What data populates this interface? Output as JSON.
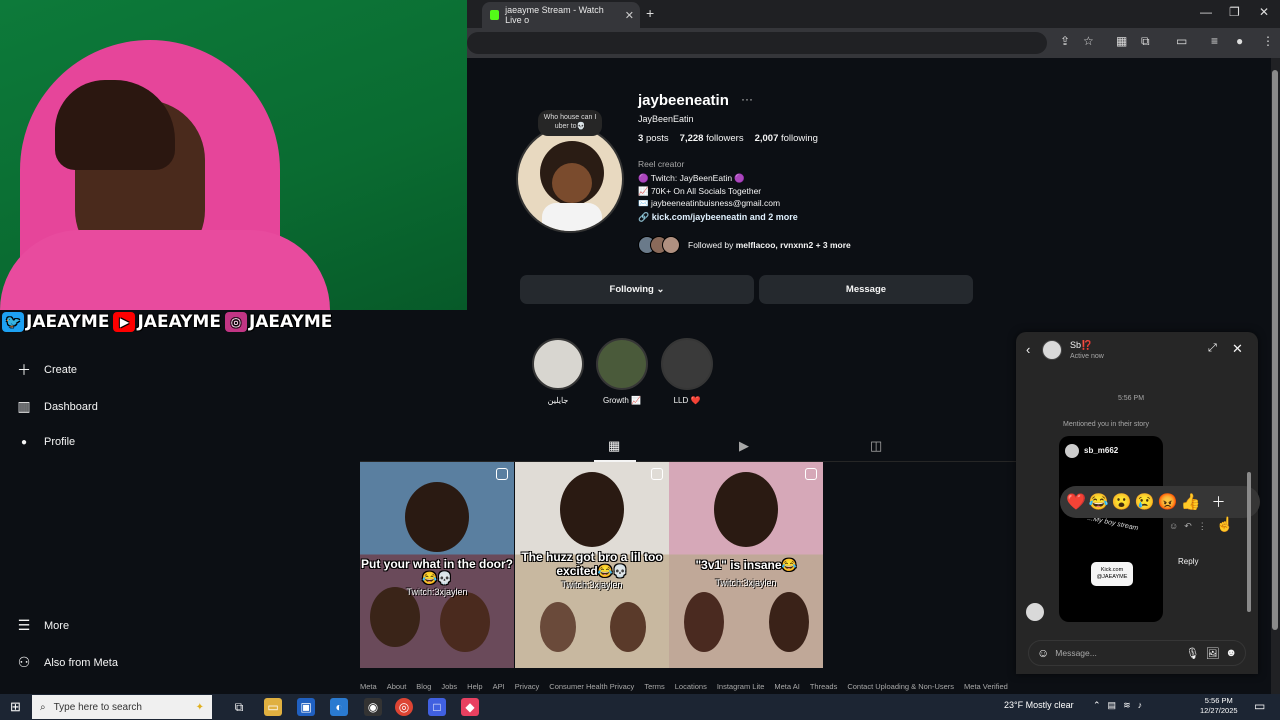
{
  "browser": {
    "tab_title": "jaeayme Stream - Watch Live o",
    "new_tab": "+",
    "close": "✕"
  },
  "stream_overlay": {
    "socials": [
      {
        "platform": "twitter-icon",
        "handle": "JAEAYME",
        "color": "#1da1f2"
      },
      {
        "platform": "youtube-icon",
        "handle": "JAEAYME",
        "color": "#ff0000"
      },
      {
        "platform": "instagram-icon",
        "handle": "JAEAYME",
        "color": "#c13584"
      }
    ]
  },
  "left_nav": {
    "items": [
      {
        "icon": "plus-icon",
        "label": "Create"
      },
      {
        "icon": "dashboard-icon",
        "label": "Dashboard"
      },
      {
        "icon": "avatar-icon",
        "label": "Profile"
      },
      {
        "icon": "menu-icon",
        "label": "More"
      },
      {
        "icon": "meta-icon",
        "label": "Also from Meta"
      }
    ]
  },
  "profile": {
    "username": "jaybeeneatin",
    "more": "···",
    "display_name": "JayBeenEatin",
    "note": "Who house can I uber to💀",
    "stats": {
      "posts": "3",
      "posts_label": "posts",
      "followers": "7,228",
      "followers_label": "followers",
      "following": "2,007",
      "following_label": "following"
    },
    "category": "Reel creator",
    "bio": [
      "🟣 Twitch: JayBeenEatin 🟣",
      "📈 70K+ On All Socials Together",
      "✉️ jaybeeneatinbuisness@gmail.com"
    ],
    "link": "kick.com/jaybeeneatin and 2 more",
    "followed_by_prefix": "Followed by",
    "followed_by_names": "melflacoo, rvnxnn2",
    "followed_by_more": "+ 3 more",
    "following_button": "Following ⌄",
    "message_button": "Message"
  },
  "highlights": [
    {
      "label": "جايلين",
      "color": "#d8d6d0"
    },
    {
      "label": "Growth 📈",
      "color": "#4a5a3a"
    },
    {
      "label": "LLD ❤️",
      "color": "#3a3a3a"
    }
  ],
  "posts": [
    {
      "caption": "Put your what in the door?😂💀",
      "sub": "Twitch:3xjaylen",
      "top": "#5a7fa0",
      "bottom": "#6a4a5a"
    },
    {
      "caption": "The huzz got bro a lil too excited😂💀",
      "sub": "Twitch:3xjaylen",
      "top": "#e0dcd6",
      "bottom": "#c8b8a0"
    },
    {
      "caption": "\"3v1\" is insane😂",
      "sub": "Twitch:3xjaylen",
      "top": "#d6a8b8",
      "bottom": "#c0a898"
    }
  ],
  "footer": [
    "Meta",
    "About",
    "Blog",
    "Jobs",
    "Help",
    "API",
    "Privacy",
    "Consumer Health Privacy",
    "Terms",
    "Locations",
    "Instagram Lite",
    "Meta AI",
    "Threads",
    "Contact Uploading & Non-Users",
    "Meta Verified"
  ],
  "chat": {
    "name": "Sb⁉️",
    "status": "Active now",
    "time": "5:56 PM",
    "mention": "Mentioned you in their story",
    "story_user": "sb_m662",
    "story_text": "...My boy stream",
    "story_sticker": "Kick.com @JAEAYME",
    "reactions": [
      "❤️",
      "😂",
      "😮",
      "😢",
      "😡",
      "👍"
    ],
    "reply": "Reply",
    "placeholder": "Message..."
  },
  "taskbar": {
    "search_placeholder": "Type here to search",
    "weather": "23°F  Mostly clear",
    "time": "5:56 PM",
    "date": "12/27/2025"
  }
}
